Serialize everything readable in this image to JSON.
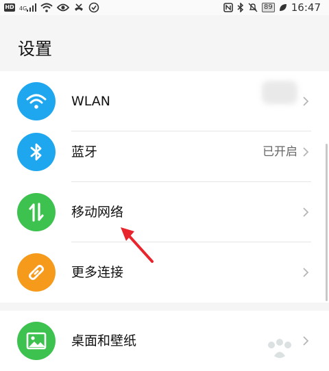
{
  "status_bar": {
    "left_icons": [
      "hd-icon",
      "signal-4g-icon",
      "wifi-icon",
      "eye-icon",
      "missed-call-icon",
      "vpn-icon"
    ],
    "hd_label": "HD",
    "network_label": "4G",
    "right_icons": [
      "nfc-icon",
      "bluetooth-icon",
      "mute-icon",
      "battery-icon",
      "leaf-icon"
    ],
    "battery": "89",
    "time": "16:47"
  },
  "page": {
    "title": "设置"
  },
  "settings": {
    "items": [
      {
        "label": "WLAN",
        "value": "",
        "icon": "wifi-icon",
        "color": "#1ea7ee"
      },
      {
        "label": "蓝牙",
        "value": "已开启",
        "icon": "bluetooth-icon",
        "color": "#1ea7ee"
      },
      {
        "label": "移动网络",
        "value": "",
        "icon": "mobile-data-icon",
        "color": "#3ec24f"
      },
      {
        "label": "更多连接",
        "value": "",
        "icon": "link-icon",
        "color": "#f59a1b"
      }
    ],
    "display_items": [
      {
        "label": "桌面和壁纸",
        "value": "",
        "icon": "image-icon",
        "color": "#3ec24f"
      }
    ]
  },
  "colors": {
    "background": "#f5f5f5",
    "card": "#ffffff",
    "arrow": "#e8252d"
  }
}
